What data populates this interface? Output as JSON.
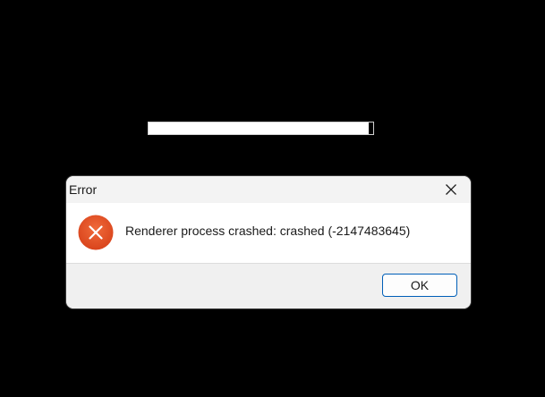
{
  "progress": {
    "value_fraction": 0.98
  },
  "dialog": {
    "title": "Error",
    "icon": "error-icon",
    "message": "Renderer process crashed: crashed (-2147483645)",
    "ok_label": "OK"
  },
  "colors": {
    "background": "#000000",
    "error_icon": "#e0502a",
    "button_border": "#005fb8"
  }
}
